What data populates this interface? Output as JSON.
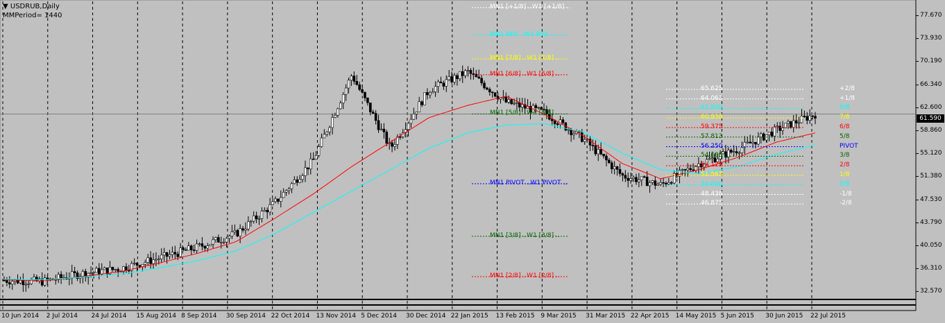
{
  "window": {
    "symbol_title": "USDRUB,Daily",
    "mm_period": "MMPeriod= 1440",
    "current_price": "61.590"
  },
  "price_axis": [
    "77.670",
    "73.930",
    "70.190",
    "66.340",
    "62.600",
    "58.860",
    "55.120",
    "51.380",
    "47.530",
    "43.790",
    "40.050",
    "36.310",
    "32.570"
  ],
  "date_axis": [
    "10 Jun 2014",
    "2 Jul 2014",
    "24 Jul 2014",
    "15 Aug 2014",
    "8 Sep 2014",
    "30 Sep 2014",
    "22 Oct 2014",
    "13 Nov 2014",
    "5 Dec 2014",
    "30 Dec 2014",
    "22 Jan 2015",
    "13 Feb 2015",
    "9 Mar 2015",
    "31 Mar 2015",
    "22 Apr 2015",
    "14 May 2015",
    "5 Jun 2015",
    "30 Jun 2015",
    "22 Jul 2015"
  ],
  "murrey_labels": [
    {
      "text": "MN1 [+1/8] ..W1 [+1/8] ..",
      "color": "#ffffff"
    },
    {
      "text": "MN1 RES ..W1 RES ..",
      "color": "#00ffff"
    },
    {
      "text": "MN1 [7/8] ..W1 [7/8] ..",
      "color": "#ffff00"
    },
    {
      "text": "MN1 [6/8] ..W1 [6/8] ..",
      "color": "#ff0000"
    },
    {
      "text": "MN1 [5/8] ..W1 [5/8] ..",
      "color": "#006400"
    },
    {
      "text": "MN1 PIVOT ..W1 PIVOT ..",
      "color": "#0000ff"
    },
    {
      "text": "MN1 [3/8] ..W1 [3/8] ..",
      "color": "#006400"
    },
    {
      "text": "MN1 [2/8] ..W1 [2/8] ..",
      "color": "#ff0000"
    }
  ],
  "daily_levels": [
    {
      "value": "65.625",
      "octave": "+2/8",
      "color": "#ffffff"
    },
    {
      "value": "64.063",
      "octave": "+1/8",
      "color": "#ffffff"
    },
    {
      "value": "62.500",
      "octave": "8/8",
      "color": "#00ffff"
    },
    {
      "value": "60.938",
      "octave": "7/8",
      "color": "#ffff00"
    },
    {
      "value": "59.375",
      "octave": "6/8",
      "color": "#ff0000"
    },
    {
      "value": "57.813",
      "octave": "5/8",
      "color": "#006400"
    },
    {
      "value": "56.250",
      "octave": "PIVOT",
      "color": "#0000ff"
    },
    {
      "value": "54.688",
      "octave": "3/8",
      "color": "#006400"
    },
    {
      "value": "53.125",
      "octave": "2/8",
      "color": "#ff0000"
    },
    {
      "value": "51.563",
      "octave": "1/8",
      "color": "#ffff00"
    },
    {
      "value": "50.000",
      "octave": "0/8",
      "color": "#00ffff"
    },
    {
      "value": "48.438",
      "octave": "-1/8",
      "color": "#ffffff"
    },
    {
      "value": "46.875",
      "octave": "-2/8",
      "color": "#ffffff"
    }
  ],
  "colors": {
    "background": "#c0c0c0",
    "candle": "#000000",
    "ma_fast": "#ff0000",
    "ma_slow": "#00ffff"
  },
  "chart_data": {
    "type": "candlestick",
    "title": "USDRUB,Daily",
    "ylim": [
      31.5,
      80.0
    ],
    "x_labels": [
      "10 Jun 2014",
      "2 Jul 2014",
      "24 Jul 2014",
      "15 Aug 2014",
      "8 Sep 2014",
      "30 Sep 2014",
      "22 Oct 2014",
      "13 Nov 2014",
      "5 Dec 2014",
      "30 Dec 2014",
      "22 Jan 2015",
      "13 Feb 2015",
      "9 Mar 2015",
      "31 Mar 2015",
      "22 Apr 2015",
      "14 May 2015",
      "5 Jun 2015",
      "30 Jun 2015",
      "22 Jul 2015"
    ],
    "close_series": {
      "name": "USDRUB",
      "dates": [
        "10 Jun 2014",
        "2 Jul 2014",
        "24 Jul 2014",
        "15 Aug 2014",
        "8 Sep 2014",
        "30 Sep 2014",
        "22 Oct 2014",
        "13 Nov 2014",
        "5 Dec 2014",
        "16 Dec 2014",
        "30 Dec 2014",
        "22 Jan 2015",
        "30 Jan 2015",
        "13 Feb 2015",
        "9 Mar 2015",
        "31 Mar 2015",
        "22 Apr 2015",
        "14 May 2015",
        "5 Jun 2015",
        "30 Jun 2015",
        "22 Jul 2015",
        "28 Jul 2015"
      ],
      "values": [
        34.4,
        34.2,
        35.5,
        36.3,
        38.0,
        39.8,
        42.0,
        47.0,
        54.0,
        68.0,
        56.0,
        65.5,
        68.5,
        63.5,
        61.8,
        57.5,
        51.5,
        50.0,
        53.5,
        55.8,
        59.0,
        61.59
      ]
    },
    "moving_averages": [
      {
        "color": "#ff0000",
        "values": [
          34.5,
          34.3,
          35.0,
          35.8,
          37.2,
          38.8,
          40.7,
          44.5,
          48.5,
          53.0,
          57.0,
          61.0,
          63.0,
          64.5,
          61.5,
          58.0,
          53.5,
          51.0,
          52.5,
          54.5,
          57.0,
          58.5
        ]
      },
      {
        "color": "#00ffff",
        "values": [
          34.6,
          34.5,
          34.9,
          35.4,
          36.4,
          37.6,
          39.2,
          42.0,
          45.5,
          49.0,
          52.5,
          56.0,
          58.5,
          59.8,
          60.0,
          58.6,
          55.2,
          52.5,
          51.8,
          53.0,
          55.0,
          56.5
        ]
      }
    ]
  }
}
